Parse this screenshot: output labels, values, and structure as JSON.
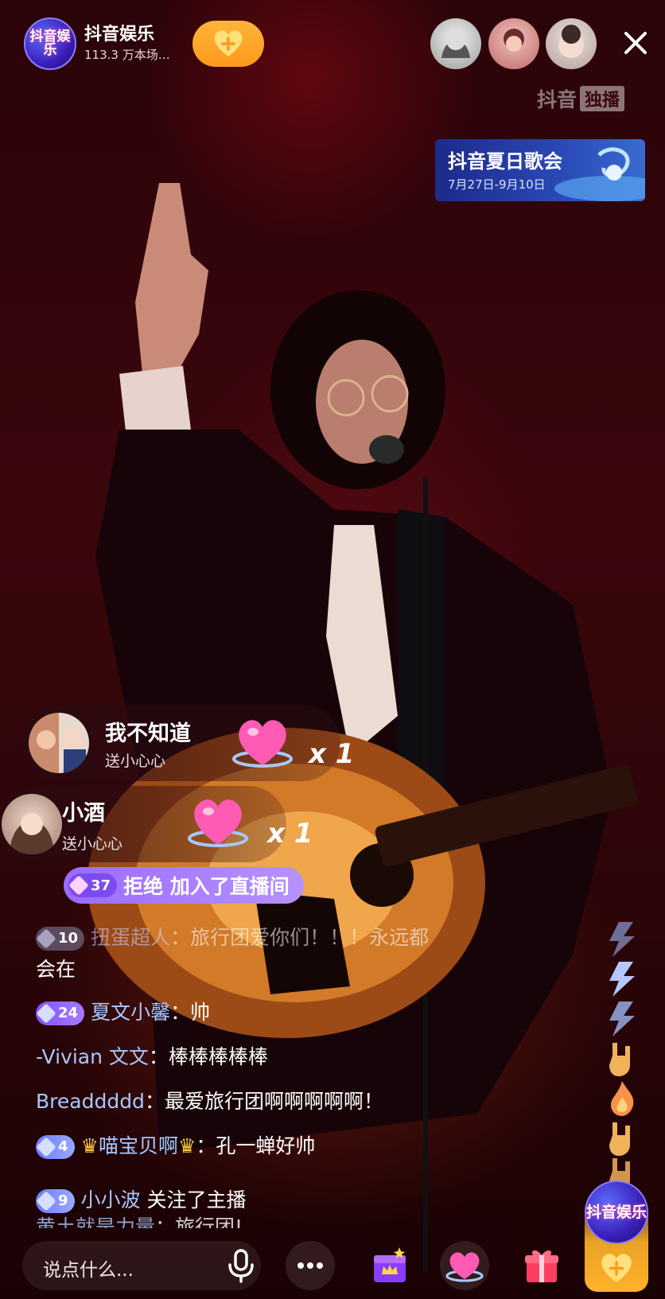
{
  "header": {
    "anchor_logo_text": "抖音娱乐",
    "anchor_name": "抖音娱乐",
    "anchor_stat": "113.3 万本场…",
    "follow_icon": "heart-plus-icon",
    "close_icon": "close-icon",
    "viewers": [
      "viewer-avatar-1",
      "viewer-avatar-2",
      "viewer-avatar-3"
    ]
  },
  "watermark": {
    "brand": "抖音",
    "tag": "独播"
  },
  "banner": {
    "title": "抖音夏日歌会",
    "date": "7月27日-9月10日"
  },
  "gifts": [
    {
      "name": "我不知道",
      "sub": "送小心心",
      "count": "x 1"
    },
    {
      "name": "小酒",
      "sub": "送小心心",
      "count": "x 1"
    }
  ],
  "join": {
    "level": "37",
    "text": "拒绝 加入了直播间"
  },
  "chat": [
    {
      "level": "10",
      "name": "扭蛋超人",
      "msg": "：旅行团爱你们！！！永远都",
      "cont": "会在"
    },
    {
      "level": "24",
      "name": "夏文小馨",
      "msg": "：帅"
    },
    {
      "name": "-Vivian 文文",
      "msg": "：棒棒棒棒棒"
    },
    {
      "name": "Breaddddd",
      "msg": "：最爱旅行团啊啊啊啊啊！"
    },
    {
      "level": "4",
      "name": "喵宝贝啊",
      "msg": "：孔一蝉好帅"
    },
    {
      "level": "9",
      "name": "小小波",
      "msg": " 关注了主播"
    },
    {
      "name": "黄土就是力量",
      "msg": "：旅行团!"
    }
  ],
  "bottom": {
    "input_placeholder": "说点什么...",
    "mic_icon": "microphone-icon",
    "more_icon": "more-icon",
    "fan_icon": "crown-gift-icon",
    "like_icon": "heart-icon",
    "gift_icon": "gift-icon",
    "stack_logo_text": "抖音娱乐"
  },
  "colors": {
    "accent_orange": "#ffa62b",
    "level_purple": "#8e5cff",
    "chat_name": "#aac8ff"
  }
}
